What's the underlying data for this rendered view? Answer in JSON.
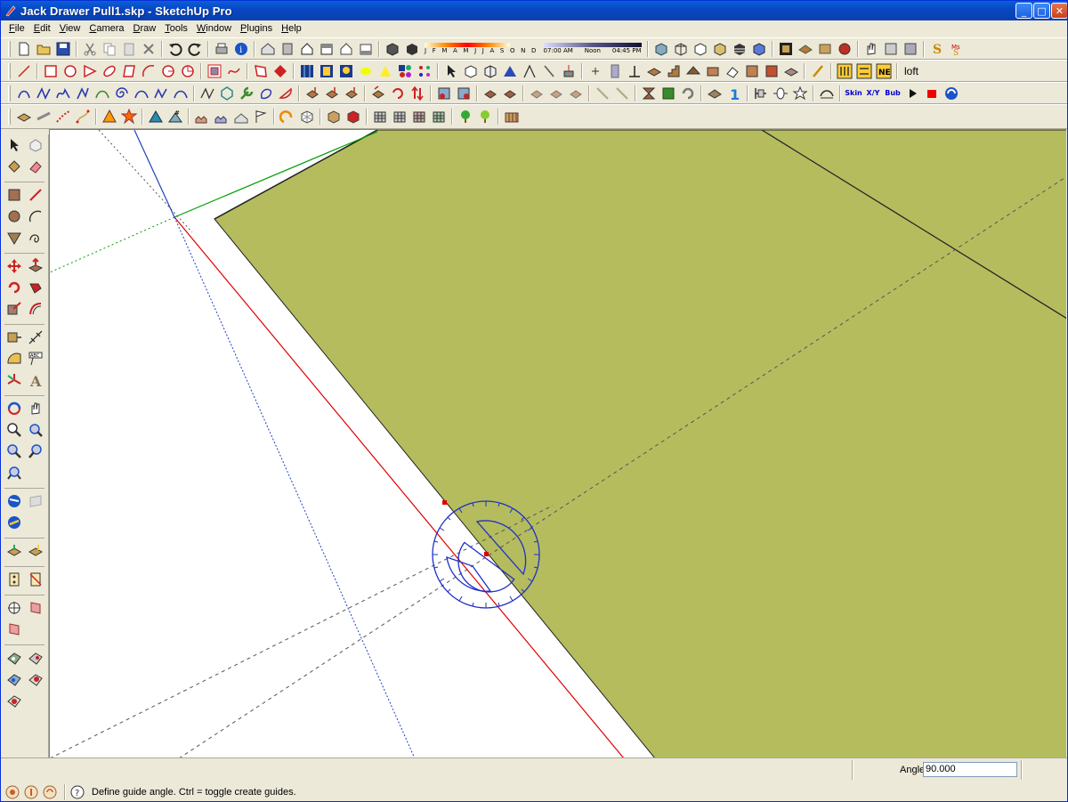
{
  "window": {
    "title": "Jack Drawer Pull1.skp - SketchUp Pro",
    "minimize": "_",
    "maximize": "□",
    "close": "✕"
  },
  "menu": [
    {
      "key": "F",
      "rest": "ile"
    },
    {
      "key": "E",
      "rest": "dit"
    },
    {
      "key": "V",
      "rest": "iew"
    },
    {
      "key": "C",
      "rest": "amera"
    },
    {
      "key": "D",
      "rest": "raw"
    },
    {
      "key": "T",
      "rest": "ools"
    },
    {
      "key": "W",
      "rest": "indow"
    },
    {
      "key": "P",
      "rest": "lugins"
    },
    {
      "key": "H",
      "rest": "elp"
    }
  ],
  "shadows": {
    "months": "J F M A M J J A S O N D",
    "time_start": "07:00 AM",
    "time_mid": "Noon",
    "time_end": "04:45 PM"
  },
  "toolbar": {
    "loft_label": "loft",
    "skin_label": "Skin",
    "xy_label": "X/Y",
    "bub_label": "Bub"
  },
  "vcb": {
    "label": "Angle",
    "value": "90.000"
  },
  "status": {
    "message": "Define guide angle.  Ctrl = toggle create guides."
  },
  "colors": {
    "face": "#b4bc5e",
    "red_axis": "#e00000",
    "green_axis": "#00a000",
    "blue_axis": "#2040c0",
    "protractor": "#2030c8"
  }
}
